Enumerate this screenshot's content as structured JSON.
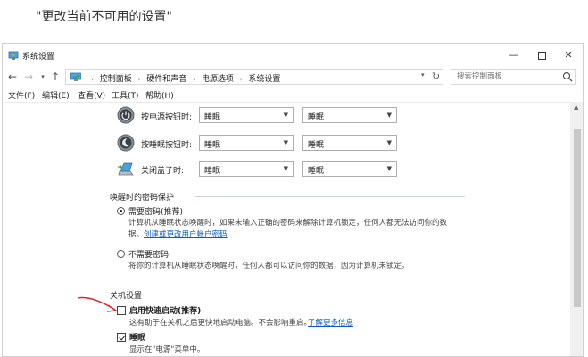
{
  "caption": "\"更改当前不可用的设置\"",
  "window": {
    "title": "系统设置",
    "controls": {
      "minimize": "—",
      "close": "✕"
    }
  },
  "address": {
    "crumbs": [
      "控制面板",
      "硬件和声音",
      "电源选项",
      "系统设置"
    ],
    "search_placeholder": "搜索控制面板"
  },
  "menu": [
    "文件(F)",
    "编辑(E)",
    "查看(V)",
    "工具(T)",
    "帮助(H)"
  ],
  "power_rows": [
    {
      "label": "按电源按钮时:",
      "battery": "睡眠",
      "plugged": "睡眠",
      "icon": "power-button-icon"
    },
    {
      "label": "按睡眠按钮时:",
      "battery": "睡眠",
      "plugged": "睡眠",
      "icon": "sleep-button-icon"
    },
    {
      "label": "关闭盖子时:",
      "battery": "睡眠",
      "plugged": "睡眠",
      "icon": "laptop-lid-icon"
    }
  ],
  "password_section": {
    "title": "唤醒时的密码保护",
    "require": {
      "label": "需要密码(推荐)",
      "desc_1": "计算机从睡眠状态唤醒时，如果未输入正确的密码来解除计算机锁定，任何人都无法访问你的数",
      "desc_2": "据。",
      "link": "创建或更改用户帐户密码",
      "checked": true
    },
    "no_require": {
      "label": "不需要密码",
      "desc": "将你的计算机从睡眠状态唤醒时，任何人都可以访问你的数据，因为计算机未锁定。",
      "checked": false
    }
  },
  "shutdown_section": {
    "title": "关机设置",
    "fast_startup": {
      "label": "启用快速启动(推荐)",
      "desc": "这有助于在关机之后更快地启动电脑。不会影响重启。",
      "link": "了解更多信息",
      "checked": false
    },
    "sleep": {
      "label": "睡眠",
      "desc": "显示在\"电源\"菜单中。",
      "checked": true
    }
  },
  "colors": {
    "link": "#0a5bc4",
    "annotation_arrow": "#d9272e"
  }
}
